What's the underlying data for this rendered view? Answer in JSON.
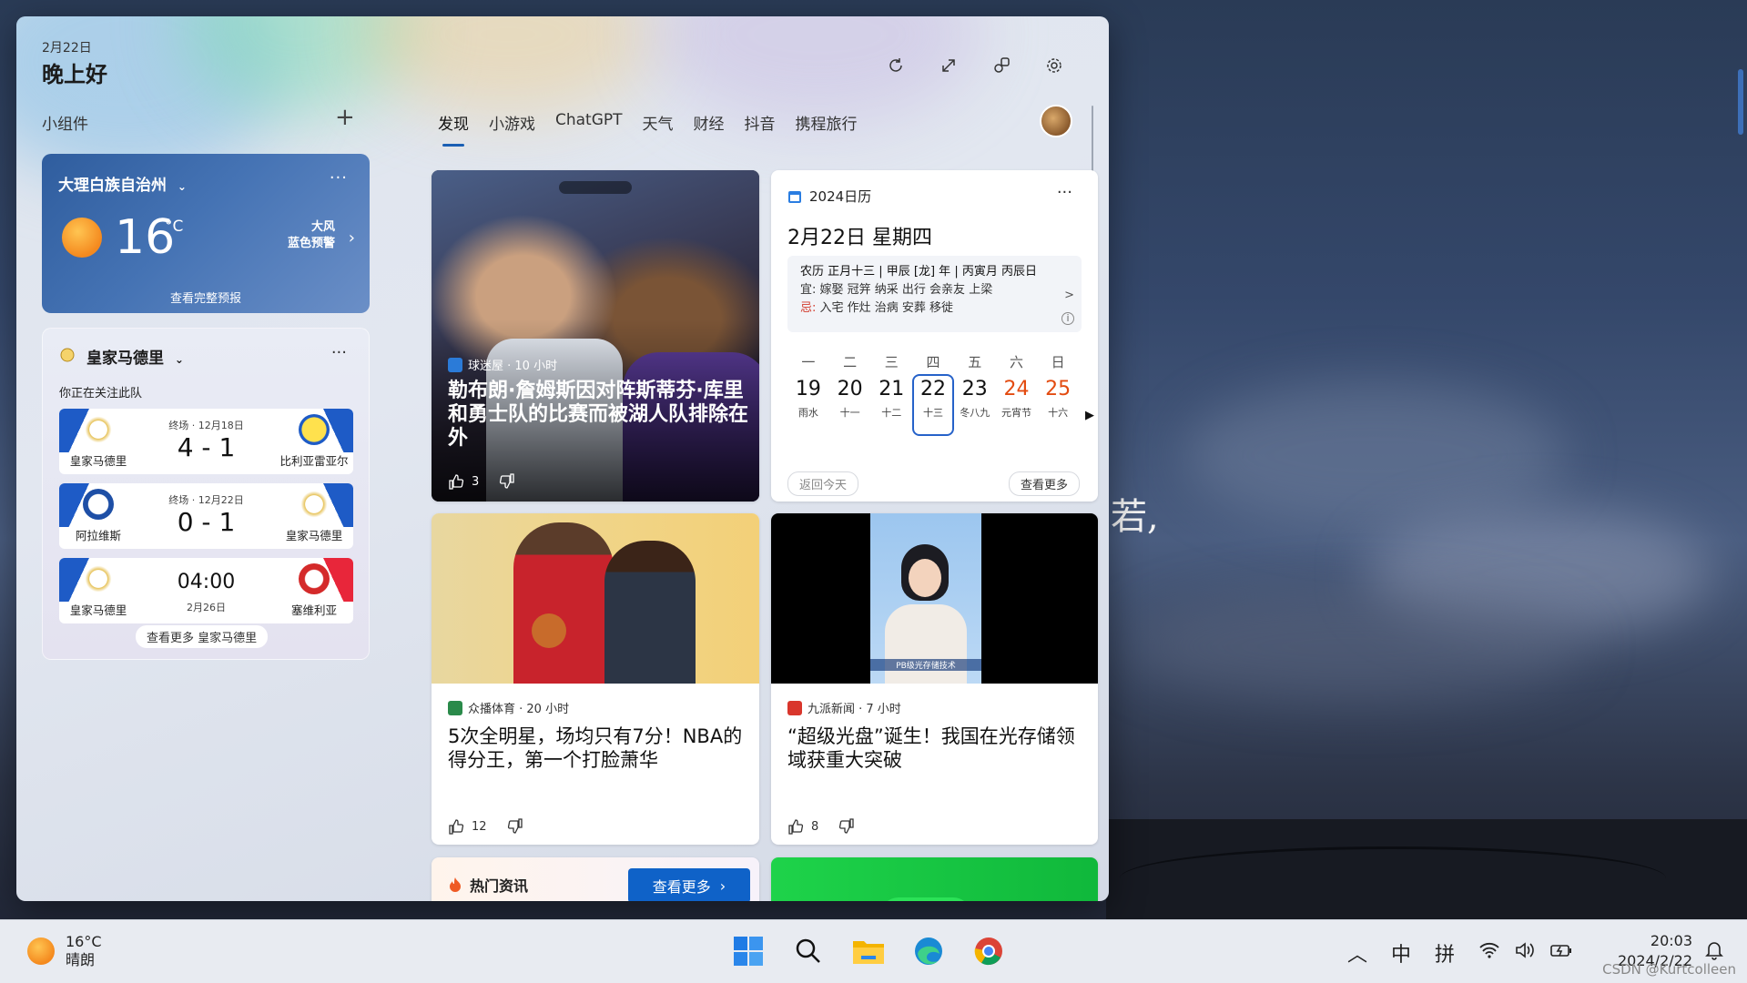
{
  "header": {
    "date": "2月22日",
    "greeting": "晚上好"
  },
  "widgets_label": "小组件",
  "tabs": [
    {
      "label": "发现",
      "active": true
    },
    {
      "label": "小游戏"
    },
    {
      "label": "ChatGPT"
    },
    {
      "label": "天气"
    },
    {
      "label": "财经"
    },
    {
      "label": "抖音"
    },
    {
      "label": "携程旅行"
    }
  ],
  "weather": {
    "city": "大理白族自治州",
    "temp": "16",
    "unit": "°C",
    "alert_line1": "大风",
    "alert_line2": "蓝色预警",
    "forecast_link": "查看完整预报"
  },
  "sports": {
    "team": "皇家马德里",
    "following": "你正在关注此队",
    "matches": [
      {
        "status": "终场 · 12月18日",
        "score": "4 - 1",
        "home": "皇家马德里",
        "away": "比利亚雷亚尔"
      },
      {
        "status": "终场 · 12月22日",
        "score": "0 - 1",
        "home": "阿拉维斯",
        "away": "皇家马德里"
      },
      {
        "time": "04:00",
        "date": "2月26日",
        "home": "皇家马德里",
        "away": "塞维利亚"
      }
    ],
    "more": "查看更多 皇家马德里"
  },
  "hero": {
    "source": "球迷屋 · 10 小时",
    "title": "勒布朗·詹姆斯因对阵斯蒂芬·库里和勇士队的比赛而被湖人队排除在外",
    "likes": "3"
  },
  "calendar": {
    "title": "2024日历",
    "date_line": "2月22日  星期四",
    "lunar": "农历 正月十三 | 甲辰 [龙] 年 | 丙寅月 丙辰日",
    "good": "嫁娶 冠笄 纳采 出行 会亲友 上梁",
    "bad": "入宅 作灶 治病 安葬 移徙",
    "good_label": "宜:",
    "bad_label": "忌:",
    "weekdays": [
      "一",
      "二",
      "三",
      "四",
      "五",
      "六",
      "日"
    ],
    "days": [
      {
        "num": "19",
        "sub": "雨水"
      },
      {
        "num": "20",
        "sub": "十一"
      },
      {
        "num": "21",
        "sub": "十二"
      },
      {
        "num": "22",
        "sub": "十三"
      },
      {
        "num": "23",
        "sub": "冬八九"
      },
      {
        "num": "24",
        "sub": "元宵节"
      },
      {
        "num": "25",
        "sub": "十六"
      }
    ],
    "today_btn": "返回今天",
    "more_btn": "查看更多"
  },
  "news": [
    {
      "source": "众播体育 · 20 小时",
      "title": "5次全明星，场均只有7分！NBA的得分王，第一个打脸萧华",
      "likes": "12"
    },
    {
      "source": "九派新闻 · 7 小时",
      "title": "“超级光盘”诞生！我国在光存储领域获重大突破",
      "likes": "8",
      "caption": "PB级光存储技术"
    }
  ],
  "hot": {
    "title": "热门资讯",
    "button": "查看更多"
  },
  "taskbar": {
    "temp": "16°C",
    "condition": "晴朗",
    "ime1": "中",
    "ime2": "拼",
    "time": "20:03",
    "date": "2024/2/22"
  },
  "wallpaper_text": "若,",
  "watermark": "CSDN @Kurtcolleen"
}
